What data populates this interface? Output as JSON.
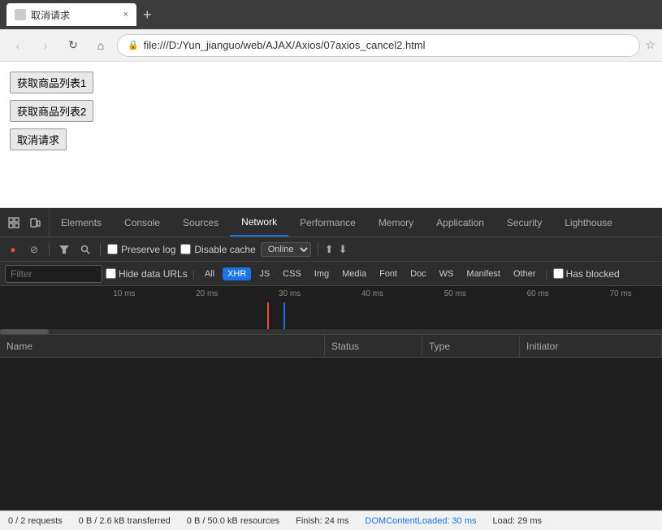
{
  "browser": {
    "tab": {
      "title": "取消请求",
      "close": "×",
      "new_tab": "+"
    },
    "nav": {
      "back": "‹",
      "forward": "›",
      "reload": "↻",
      "home": "⌂",
      "back_disabled": true,
      "forward_disabled": true
    },
    "address": "file:///D:/Yun_jianguo/web/AJAX/Axios/07axios_cancel2.html",
    "bookmark": "☆"
  },
  "page": {
    "btn1": "获取商品列表1",
    "btn2": "获取商品列表2",
    "btn3": "取消请求"
  },
  "devtools": {
    "side_icons": [
      "⊡",
      "□"
    ],
    "tabs": [
      {
        "label": "Elements",
        "active": false
      },
      {
        "label": "Console",
        "active": false
      },
      {
        "label": "Sources",
        "active": false
      },
      {
        "label": "Network",
        "active": true
      },
      {
        "label": "Performance",
        "active": false
      },
      {
        "label": "Memory",
        "active": false
      },
      {
        "label": "Application",
        "active": false
      },
      {
        "label": "Security",
        "active": false
      },
      {
        "label": "Lighthouse",
        "active": false
      }
    ]
  },
  "network": {
    "toolbar": {
      "preserve_log": "Preserve log",
      "disable_cache": "Disable cache",
      "online": "Online"
    },
    "filter": {
      "placeholder": "Filter",
      "hide_data_urls": "Hide data URLs",
      "types": [
        "All",
        "XHR",
        "JS",
        "CSS",
        "Img",
        "Media",
        "Font",
        "Doc",
        "WS",
        "Manifest",
        "Other"
      ],
      "has_blocked": "Has blocked",
      "active_type": "XHR"
    },
    "timeline": {
      "marks": [
        "10 ms",
        "20 ms",
        "30 ms",
        "40 ms",
        "50 ms",
        "60 ms",
        "70 ms"
      ]
    },
    "table": {
      "headers": [
        "Name",
        "Status",
        "Type",
        "Initiator"
      ]
    }
  },
  "status_bar": {
    "requests": "0 / 2 requests",
    "transferred": "0 B / 2.6 kB transferred",
    "resources": "0 B / 50.0 kB resources",
    "finish": "Finish: 24 ms",
    "dom_content_loaded": "DOMContentLoaded: 30 ms",
    "load": "Load: 29 ms"
  }
}
